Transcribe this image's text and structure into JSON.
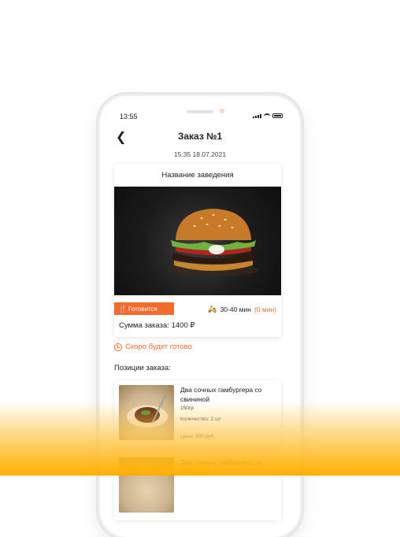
{
  "status_bar": {
    "time": "13:55"
  },
  "header": {
    "title": "Заказ №1",
    "datetime": "15:35 18.07.2021"
  },
  "order_card": {
    "venue_name": "Название заведения",
    "status": "Готовится",
    "delivery_time": "30-40 мин",
    "delivery_extra": "(0 мин)",
    "sum": "Сумма заказа: 1400 ₽"
  },
  "ready_notice": "Скоро будет готово",
  "positions_title": "Позиции заказа:",
  "items": [
    {
      "name": "Два сочных гамбургера со свининой",
      "weight": "150гр",
      "quantity": "Количество: 2 шт",
      "price": "Цена: 800 руб."
    },
    {
      "name": "Два сочных гамбургера со свининой"
    }
  ],
  "colors": {
    "accent": "#f36b2d",
    "fade": "#ffb000"
  }
}
